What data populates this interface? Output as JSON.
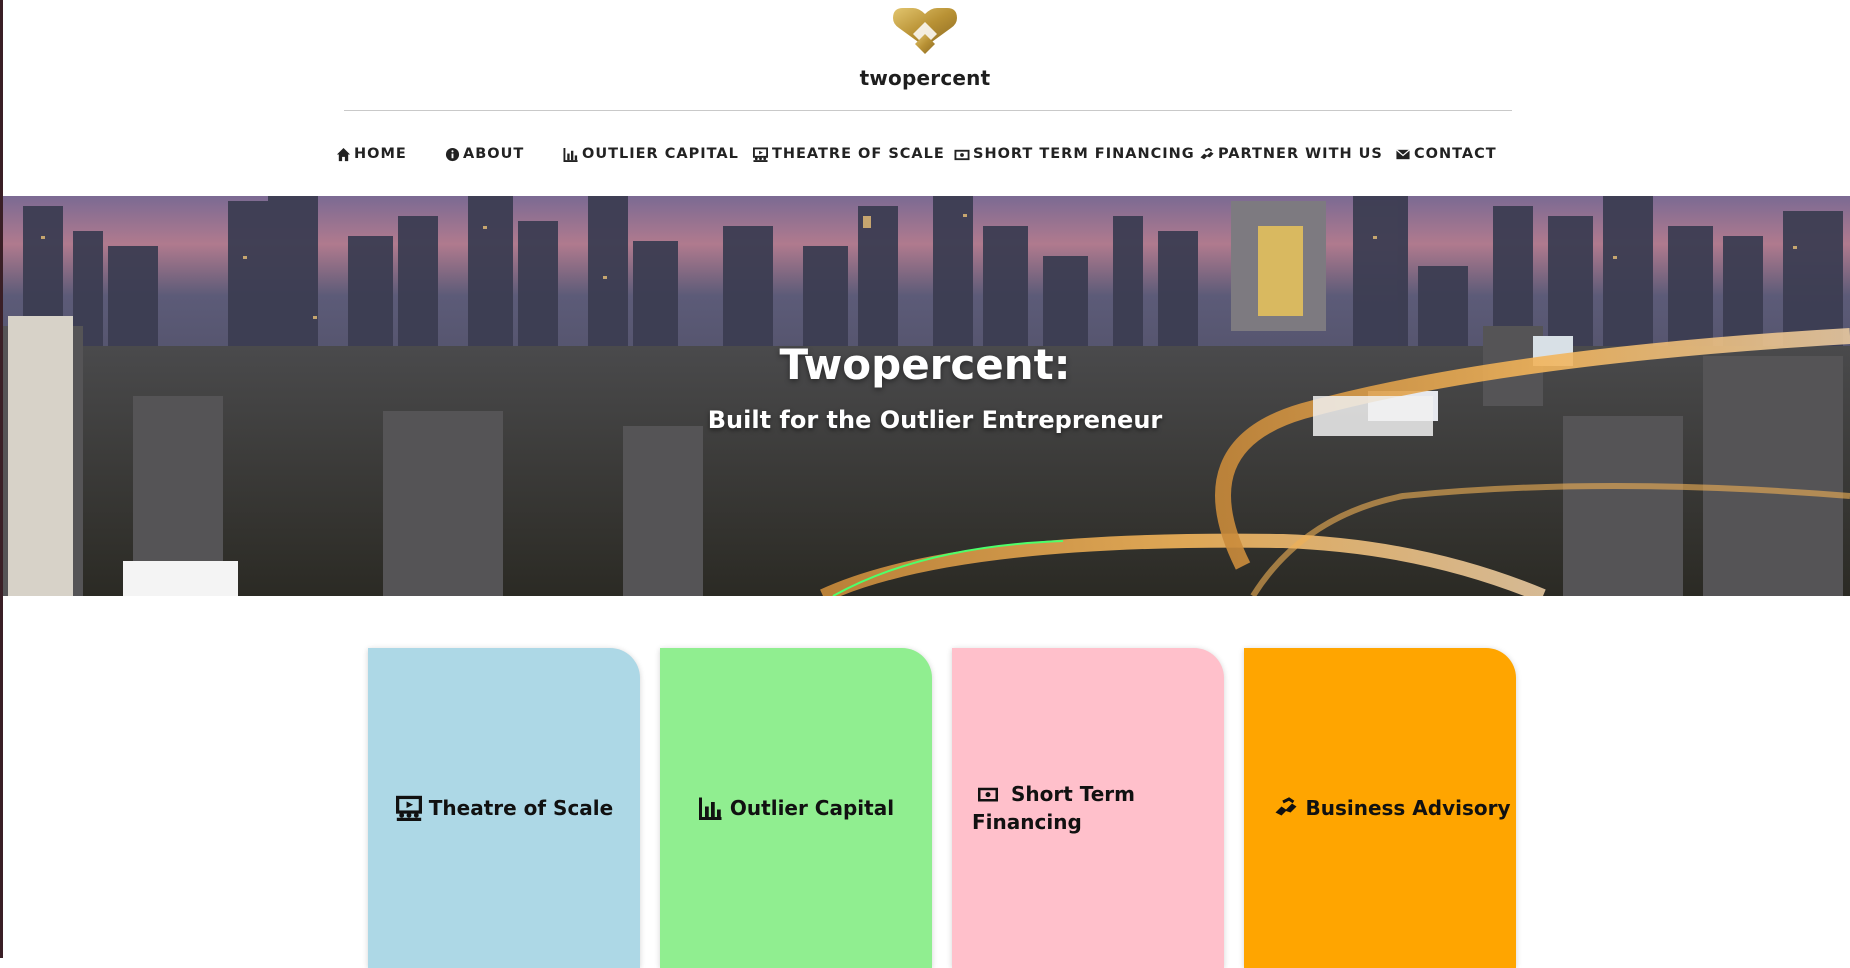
{
  "brand": {
    "name": "twopercent"
  },
  "nav": {
    "items": [
      {
        "label": "HOME",
        "icon": "home-icon"
      },
      {
        "label": "ABOUT",
        "icon": "info-icon"
      },
      {
        "label": "OUTLIER CAPITAL",
        "icon": "bar-chart-icon"
      },
      {
        "label": "THEATRE OF SCALE",
        "icon": "presentation-icon"
      },
      {
        "label": "SHORT TERM FINANCING",
        "icon": "cash-icon"
      },
      {
        "label": "PARTNER WITH US",
        "icon": "handshake-icon"
      },
      {
        "label": "CONTACT",
        "icon": "envelope-icon"
      }
    ]
  },
  "hero": {
    "title": "Twopercent:",
    "subtitle": "Built for the Outlier Entrepreneur"
  },
  "cards": [
    {
      "label": "Theatre of Scale",
      "icon": "presentation-icon",
      "color": "#add8e6"
    },
    {
      "label": "Outlier Capital",
      "icon": "bar-chart-icon",
      "color": "#90ee90"
    },
    {
      "label": "Short Term Financing",
      "icon": "cash-icon",
      "color": "#ffc0cb"
    },
    {
      "label": "Business Advisory",
      "icon": "handshake-icon",
      "color": "#ffa500"
    }
  ],
  "colors": {
    "logo_gold": "#c9a64a",
    "text_dark": "#1e1e1e"
  }
}
